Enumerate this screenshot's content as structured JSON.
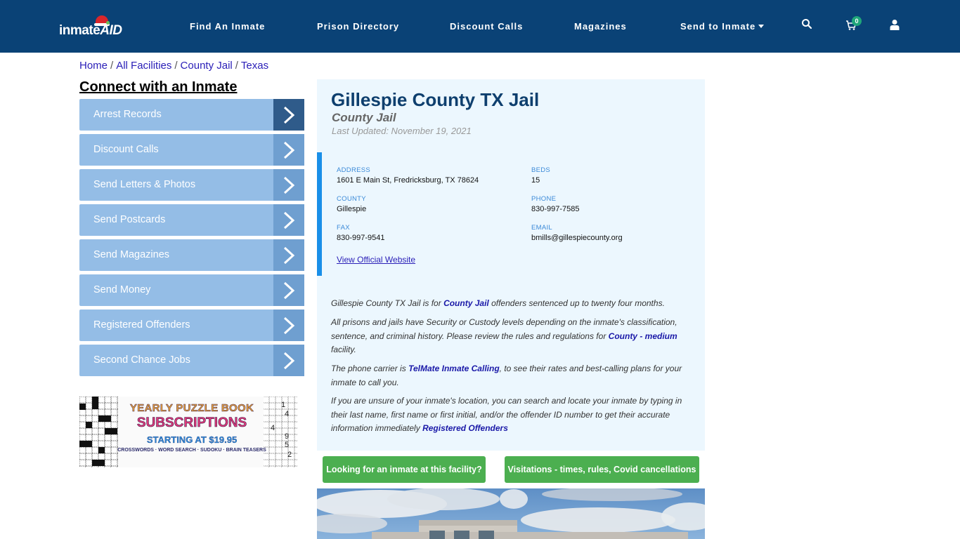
{
  "header": {
    "logo": {
      "left": "inmate",
      "right": "AID"
    },
    "nav": [
      {
        "label": "Find An Inmate"
      },
      {
        "label": "Prison Directory"
      },
      {
        "label": "Discount Calls"
      },
      {
        "label": "Magazines"
      },
      {
        "label": "Send to Inmate",
        "dropdown": true
      }
    ],
    "icons": {
      "search": "search-icon",
      "cart": "cart-icon",
      "user": "user-icon"
    },
    "cart_count": "0",
    "colors": {
      "bar": "#0a4276",
      "badge": "#1fa67a"
    }
  },
  "breadcrumb": {
    "items": [
      "Home",
      "All Facilities",
      "County Jail",
      "Texas"
    ],
    "separator": "/"
  },
  "sidebar": {
    "title": "Connect with an Inmate",
    "items": [
      {
        "label": "Arrest Records"
      },
      {
        "label": "Discount Calls"
      },
      {
        "label": "Send Letters & Photos"
      },
      {
        "label": "Send Postcards"
      },
      {
        "label": "Send Magazines"
      },
      {
        "label": "Send Money"
      },
      {
        "label": "Registered Offenders"
      },
      {
        "label": "Second Chance Jobs"
      }
    ],
    "ad": {
      "line1": "YEARLY PUZZLE BOOK",
      "line2": "SUBSCRIPTIONS",
      "line3": "STARTING AT $19.95",
      "line4": "CROSSWORDS · WORD SEARCH · SUDOKU · BRAIN TEASERS"
    }
  },
  "facility": {
    "name": "Gillespie County TX Jail",
    "type": "County Jail",
    "last_updated": "Last Updated: November 19, 2021",
    "fields": {
      "address": {
        "label": "ADDRESS",
        "value": "1601 E Main St, Fredricksburg, TX 78624"
      },
      "beds": {
        "label": "BEDS",
        "value": "15"
      },
      "county": {
        "label": "COUNTY",
        "value": "Gillespie"
      },
      "phone": {
        "label": "PHONE",
        "value": "830-997-7585"
      },
      "fax": {
        "label": "FAX",
        "value": "830-997-9541"
      },
      "email": {
        "label": "EMAIL",
        "value": "bmills@gillespiecounty.org"
      }
    },
    "website_link": "View Official Website",
    "paragraphs": {
      "p1": {
        "a": "Gillespie County TX Jail is for ",
        "link": "County Jail",
        "b": " offenders sentenced up to twenty four months."
      },
      "p2": {
        "a": "All prisons and jails have Security or Custody levels depending on the inmate's classification, sentence, and criminal history. Please review the rules and regulations for ",
        "link": "County - medium",
        "b": " facility."
      },
      "p3": {
        "a": "The phone carrier is ",
        "link": "TelMate Inmate Calling",
        "b": ", to see their rates and best-calling plans for your inmate to call you."
      },
      "p4": {
        "a": "If you are unsure of your inmate's location, you can search and locate your inmate by typing in their last name, first name or first initial, and/or the offender ID number to get their accurate information immediately ",
        "link": "Registered Offenders",
        "b": ""
      }
    },
    "buttons": {
      "find_inmate": "Looking for an inmate at this facility?",
      "visitations": "Visitations - times, rules, Covid cancellations"
    }
  }
}
